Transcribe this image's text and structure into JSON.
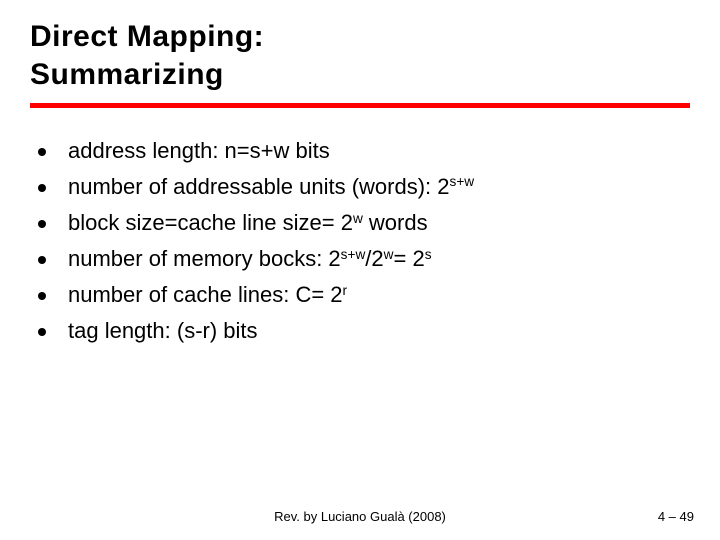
{
  "title_line1": "Direct Mapping:",
  "title_line2": "Summarizing",
  "bullets": [
    {
      "pre": "address length: n=s+w bits",
      "sup": "",
      "post": ""
    },
    {
      "pre": "number of addressable units (words): 2",
      "sup": "s+w",
      "post": ""
    },
    {
      "pre": "block size=cache line size= 2",
      "sup": "w",
      "post": " words"
    },
    {
      "pre": "number of memory bocks: 2",
      "sup": "s+w",
      "mid": "/2",
      "sup2": "w",
      "mid2": "= 2",
      "sup3": "s",
      "post": ""
    },
    {
      "pre": "number of cache lines: C= 2",
      "sup": "r",
      "post": ""
    },
    {
      "pre": "tag length: (s-r) bits",
      "sup": "",
      "post": ""
    }
  ],
  "footer_center": "Rev. by Luciano Gualà (2008)",
  "footer_right_prefix": "4 – ",
  "footer_right_page": "49"
}
